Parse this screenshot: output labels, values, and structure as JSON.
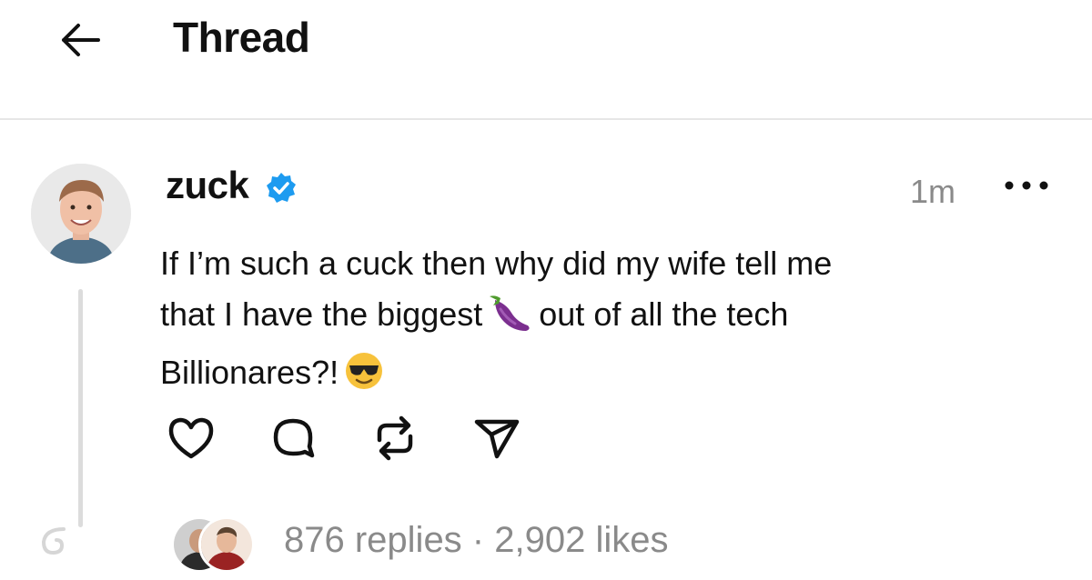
{
  "header": {
    "back_icon": "arrow-left-icon",
    "title": "Thread"
  },
  "post": {
    "author": {
      "username": "zuck",
      "verified_icon": "verified-badge-icon",
      "avatar": "profile-photo"
    },
    "timestamp": "1m",
    "more_icon": "more-dots-icon",
    "text_lines": [
      "If I’m such a cuck then why did my wife tell me",
      "that I have the biggest",
      "out of all the tech",
      "Billionares?!"
    ],
    "emojis": [
      "eggplant-emoji",
      "sunglasses-emoji"
    ],
    "actions": [
      {
        "icon": "heart-icon"
      },
      {
        "icon": "comment-icon"
      },
      {
        "icon": "repost-icon"
      },
      {
        "icon": "share-icon"
      }
    ],
    "stats": {
      "replies": "876 replies",
      "separator": " · ",
      "likes": "2,902 likes"
    }
  },
  "colors": {
    "text": "#111111",
    "muted": "#8a8a8a",
    "verified": "#1d9bf0",
    "divider": "#e6e6e6"
  }
}
